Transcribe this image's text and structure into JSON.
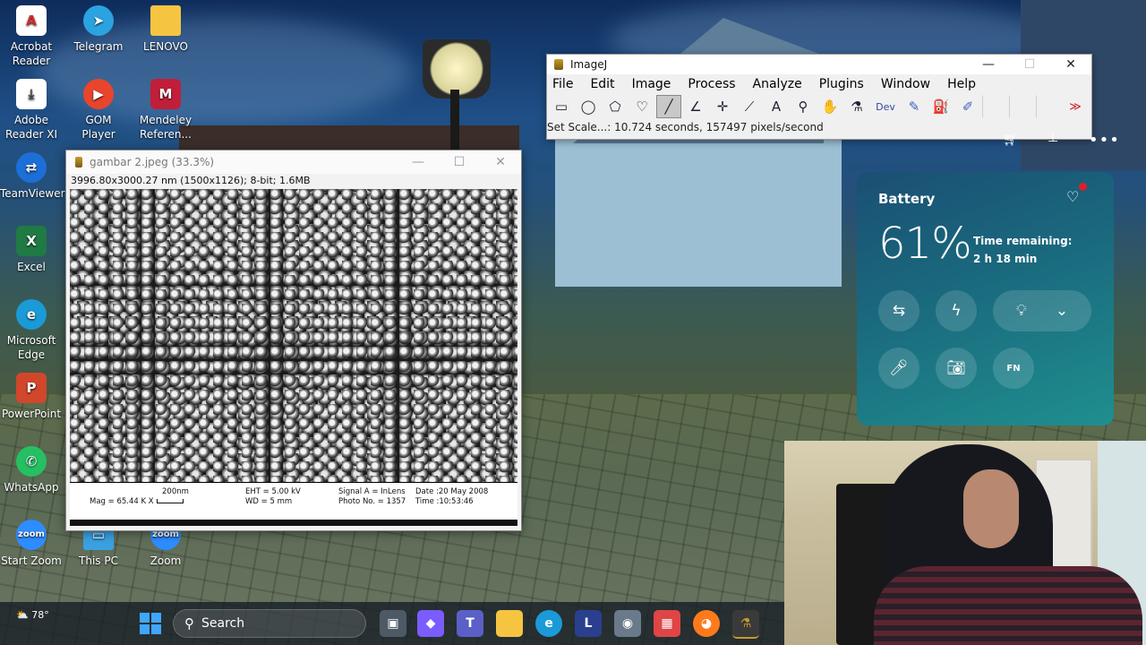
{
  "desktop_icons": [
    {
      "label": "Acrobat Reader",
      "icon": "acrobat-icon",
      "color": "#d42a2a"
    },
    {
      "label": "Telegram",
      "icon": "telegram-icon",
      "color": "#2aa3e0"
    },
    {
      "label": "LENOVO",
      "icon": "folder-icon",
      "color": "#f5c542"
    },
    {
      "label": "Adobe Reader XI",
      "icon": "adobe-reader-icon",
      "color": "#ffffff"
    },
    {
      "label": "GOM Player",
      "icon": "gom-player-icon",
      "color": "#e8452c"
    },
    {
      "label": "Mendeley Referen...",
      "icon": "mendeley-icon",
      "color": "#c21e3a"
    },
    {
      "label": "TeamViewer",
      "icon": "teamviewer-icon",
      "color": "#1d6fd8"
    },
    {
      "label": "Excel",
      "icon": "excel-icon",
      "color": "#1f7a44"
    },
    {
      "label": "Microsoft Edge",
      "icon": "edge-icon",
      "color": "#1a9ad6"
    },
    {
      "label": "PowerPoint",
      "icon": "powerpoint-icon",
      "color": "#d0472c"
    },
    {
      "label": "WhatsApp",
      "icon": "whatsapp-icon",
      "color": "#25c062"
    },
    {
      "label": "Start Zoom",
      "icon": "zoom-icon",
      "color": "#2d8cff"
    },
    {
      "label": "This PC",
      "icon": "this-pc-icon",
      "color": "#3aa0e0"
    },
    {
      "label": "Zoom",
      "icon": "zoom-icon",
      "color": "#2d8cff"
    }
  ],
  "imagej": {
    "title": "ImageJ",
    "menu": [
      "File",
      "Edit",
      "Image",
      "Process",
      "Analyze",
      "Plugins",
      "Window",
      "Help"
    ],
    "tools": [
      "rectangle-tool",
      "oval-tool",
      "polygon-tool",
      "freehand-tool",
      "line-tool",
      "angle-tool",
      "point-tool",
      "wand-tool",
      "text-tool",
      "magnifier-tool",
      "hand-tool",
      "dropper-tool",
      "dev-menu",
      "brush-tool",
      "flood-fill-tool",
      "pencil-tool"
    ],
    "dev_label": "Dev",
    "status": "Set Scale...: 10.724 seconds, 157497 pixels/second"
  },
  "image_window": {
    "title": "gambar 2.jpeg (33.3%)",
    "info": "3996.80x3000.27 nm (1500x1126); 8-bit; 1.6MB",
    "sem": {
      "scale_label": "200nm",
      "mag": "Mag = 65.44 K X",
      "eht": "EHT = 5.00 kV",
      "wd": "WD =   5 mm",
      "signal": "Signal A = InLens",
      "photo": "Photo No. = 1357",
      "date": "Date :20 May 2008",
      "time": "Time :10:53:46"
    }
  },
  "battery": {
    "title": "Battery",
    "percent": "61%",
    "remaining_label": "Time remaining:",
    "remaining_value": "2 h 18 min",
    "fn_label": "FN"
  },
  "taskbar": {
    "weather": "78°",
    "search_placeholder": "Search",
    "apps": [
      {
        "icon": "file-explorer-icon",
        "color": "#f2b530"
      },
      {
        "icon": "copilot-icon",
        "color": "#7a5cff"
      },
      {
        "icon": "teams-icon",
        "color": "#5b5fc7"
      },
      {
        "icon": "folder-icon",
        "color": "#f5c542"
      },
      {
        "icon": "edge-icon",
        "color": "#1a9ad6"
      },
      {
        "icon": "l-app-icon",
        "color": "#2b3f8f",
        "label": "L"
      },
      {
        "icon": "camera-icon",
        "color": "#6a7a8a"
      },
      {
        "icon": "store-icon",
        "color": "#e04545"
      },
      {
        "icon": "firefox-icon",
        "color": "#ff7a1a"
      },
      {
        "icon": "imagej-icon",
        "color": "#c89a2a"
      }
    ]
  }
}
